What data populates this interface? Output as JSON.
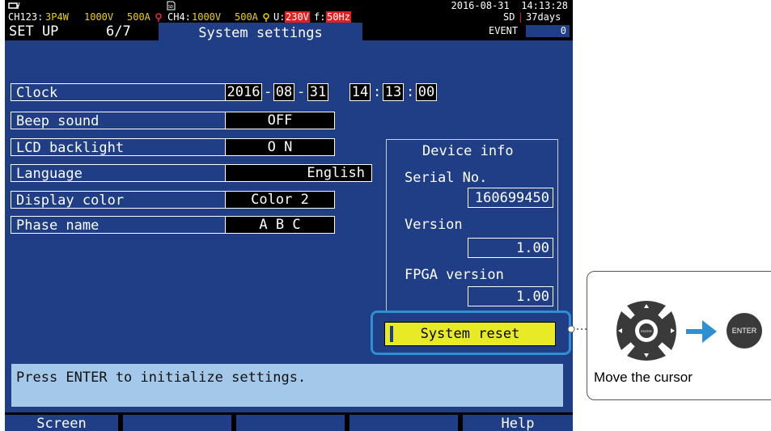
{
  "status": {
    "channel_a": "CH123:",
    "wiring": "3P4W",
    "voltage_a": "1000V",
    "current_a": "500A",
    "channel_b": "CH4:",
    "voltage_b": "1000V",
    "current_b": "500A",
    "u_label": "U:",
    "u_value": "230V",
    "f_label": "f:",
    "f_value": "50Hz",
    "datetime": "2016-08-31  14:13:28",
    "sd_label": "SD",
    "sd_days": "37days"
  },
  "header": {
    "mode": "SET UP",
    "page": "6/7",
    "title": "System settings",
    "event_label": "EVENT",
    "event_count": "0"
  },
  "settings": {
    "clock_label": "Clock",
    "clock": {
      "year": "2016",
      "month": "08",
      "day": "31",
      "hour": "14",
      "minute": "13",
      "second": "00",
      "date_sep": "-",
      "time_sep": ":"
    },
    "beep_label": "Beep sound",
    "beep_value": "OFF",
    "backlight_label": "LCD backlight",
    "backlight_value": "O N",
    "language_label": "Language",
    "language_value": "English",
    "color_label": "Display color",
    "color_value": "Color 2",
    "phase_label": "Phase name",
    "phase_value": "A B C"
  },
  "device_info": {
    "title": "Device info",
    "serial_label": "Serial No.",
    "serial_value": "160699450",
    "version_label": "Version",
    "version_value": "1.00",
    "fpga_label": "FPGA version",
    "fpga_value": "1.00"
  },
  "actions": {
    "system_reset": "System reset"
  },
  "message": "Press ENTER to initialize settings.",
  "function_keys": {
    "f1": "Screen",
    "f2": "",
    "f3": "",
    "f4": "",
    "f5": "Help"
  },
  "callout": {
    "enter_label": "ENTER",
    "caption": "Move the cursor"
  },
  "colors": {
    "screen_bg": "#1f3e86",
    "highlight": "#e9ea26",
    "callout_blue": "#2f8fd3",
    "message_bg": "#a4c8ea"
  }
}
